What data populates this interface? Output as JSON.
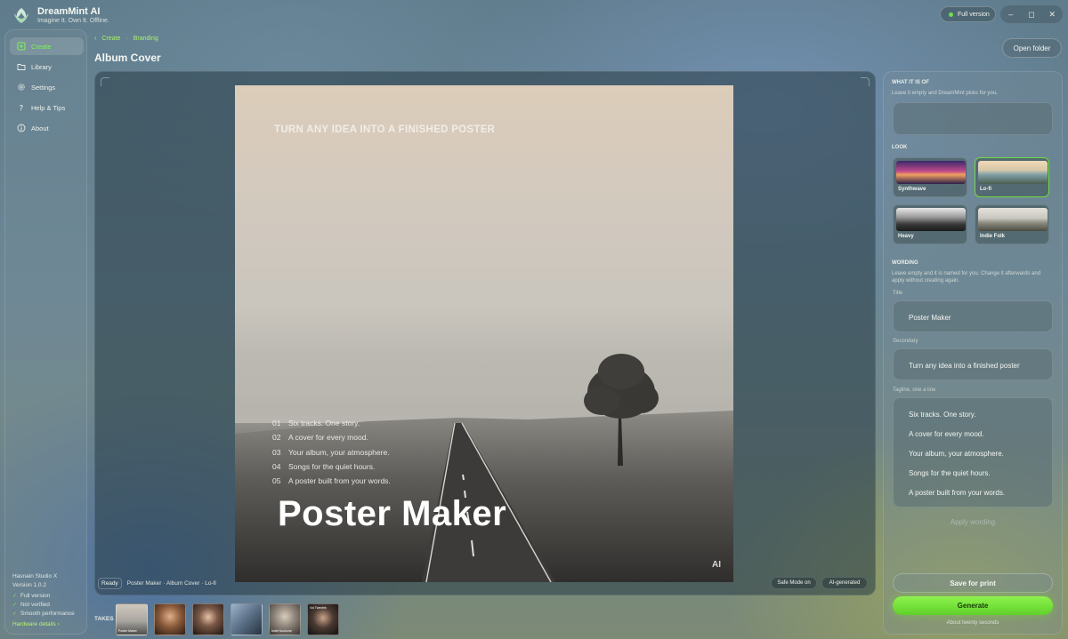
{
  "app": {
    "name": "DreamMint AI",
    "tagline": "Imagine It. Own It. Offline.",
    "version_badge": "Full version"
  },
  "window": {
    "minimize": "–",
    "maximize": "◻",
    "close": "✕"
  },
  "sidebar": {
    "items": [
      {
        "label": "Create",
        "icon": "create-icon",
        "active": true
      },
      {
        "label": "Library",
        "icon": "folder-icon"
      },
      {
        "label": "Settings",
        "icon": "gear-icon"
      },
      {
        "label": "Help & Tips",
        "icon": "question-icon"
      },
      {
        "label": "About",
        "icon": "info-icon"
      }
    ],
    "studio": "Hasnain Studio X",
    "version": "Version 1.0.2",
    "checks": [
      "Full version",
      "Not verified",
      "Smooth performance"
    ],
    "hardware_link": "Hardware details ›"
  },
  "breadcrumb": {
    "back": "‹",
    "first": "Create",
    "second": "Branding"
  },
  "page_title": "Album Cover",
  "open_folder": "Open folder",
  "poster": {
    "subtitle": "TURN ANY IDEA INTO A FINISHED POSTER",
    "title": "Poster Maker",
    "ai_mark": "AI",
    "tracks": [
      {
        "num": "01",
        "text": "Six tracks. One story."
      },
      {
        "num": "02",
        "text": "A cover for every mood."
      },
      {
        "num": "03",
        "text": "Your album, your atmosphere."
      },
      {
        "num": "04",
        "text": "Songs for the quiet hours."
      },
      {
        "num": "05",
        "text": "A poster built from your words."
      }
    ]
  },
  "status": {
    "ready": "Ready",
    "info": "Poster Maker · Album Cover · Lo-fi",
    "safe_mode": "Safe Mode on",
    "ai_generated": "AI-generated"
  },
  "takes": {
    "label": "TAKES",
    "captions": [
      "Poster Maker",
      "",
      "",
      "",
      "Indie Nocturne",
      "Vol Twentek"
    ]
  },
  "right": {
    "what_title": "WHAT IT IS OF",
    "what_hint": "Leave it empty and DreamMint picks for you.",
    "what_value": "",
    "look_title": "LOOK",
    "looks": [
      {
        "label": "Synthwave",
        "selected": false
      },
      {
        "label": "Lo-fi",
        "selected": true
      },
      {
        "label": "Heavy",
        "selected": false
      },
      {
        "label": "Indie Folk",
        "selected": false
      }
    ],
    "wording_title": "WORDING",
    "wording_hint": "Leave empty and it is named for you. Change it afterwards and apply without creating again.",
    "title_label": "Title",
    "title_value": "Poster Maker",
    "secondary_label": "Secondary",
    "secondary_value": "Turn any idea into a finished poster",
    "tagline_label": "Tagline, one a line",
    "tagline_lines": [
      "Six tracks. One story.",
      "A cover for every mood.",
      "Your album, your atmosphere.",
      "Songs for the quiet hours.",
      "A poster built from your words."
    ],
    "apply_wording": "Apply wording",
    "save_print": "Save for print",
    "generate": "Generate",
    "about_time": "About twenty seconds"
  }
}
